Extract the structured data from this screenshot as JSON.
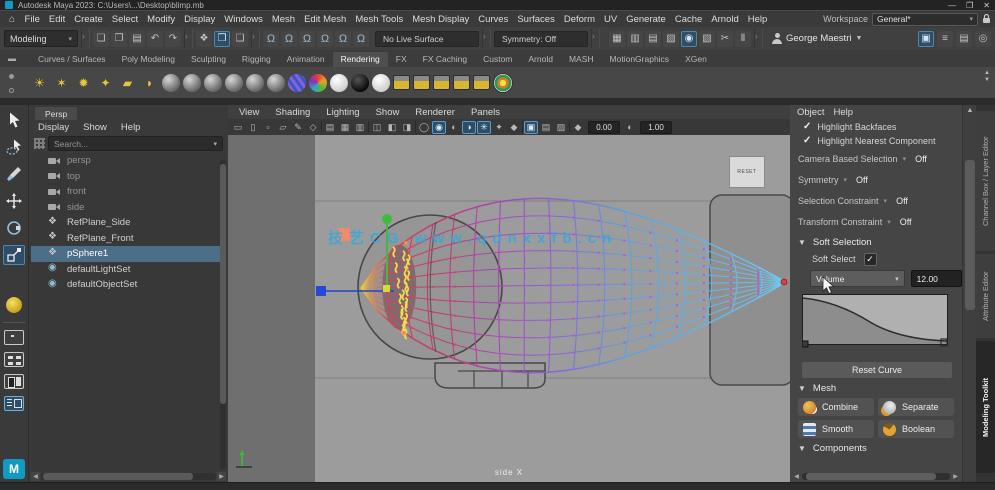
{
  "window": {
    "title": "Autodesk Maya 2023: C:\\Users\\...\\Desktop\\blimp.mb",
    "minimize": "—",
    "maximize": "❐",
    "close": "✕"
  },
  "menubar": {
    "home_icon": "⌂",
    "items": [
      "File",
      "Edit",
      "Create",
      "Select",
      "Modify",
      "Display",
      "Windows",
      "Mesh",
      "Edit Mesh",
      "Mesh Tools",
      "Mesh Display",
      "Curves",
      "Surfaces",
      "Deform",
      "UV",
      "Generate",
      "Cache",
      "Arnold",
      "Help"
    ],
    "workspace_label": "Workspace",
    "workspace_value": "General*",
    "workspace_arrow": "▾"
  },
  "statusline": {
    "mode": "Modeling",
    "mode_arrow": "▾",
    "file_icons": [
      {
        "name": "new-scene-icon",
        "glyph": "❏"
      },
      {
        "name": "open-scene-icon",
        "glyph": "❐"
      },
      {
        "name": "save-scene-icon",
        "glyph": "▤"
      },
      {
        "name": "undo-icon",
        "glyph": "↶"
      },
      {
        "name": "redo-icon",
        "glyph": "↷"
      }
    ],
    "select_icons": [
      {
        "name": "select-hierarchy-icon",
        "glyph": "❖"
      },
      {
        "name": "select-object-icon",
        "glyph": "❒",
        "active": true
      },
      {
        "name": "select-component-icon",
        "glyph": "❑"
      }
    ],
    "snap_icons": [
      {
        "name": "snap-grid-icon",
        "glyph": "Ω"
      },
      {
        "name": "snap-curve-icon",
        "glyph": "Ω"
      },
      {
        "name": "snap-point-icon",
        "glyph": "Ω"
      },
      {
        "name": "snap-projected-center-icon",
        "glyph": "Ω"
      },
      {
        "name": "snap-view-plane-icon",
        "glyph": "Ω"
      },
      {
        "name": "make-live-icon",
        "glyph": "Ω"
      }
    ],
    "live_surface": "No Live Surface",
    "symmetry": "Symmetry: Off",
    "render_icons": [
      {
        "name": "render-view-icon",
        "glyph": "▦"
      },
      {
        "name": "ipr-render-icon",
        "glyph": "▥"
      },
      {
        "name": "render-settings-icon",
        "glyph": "▤"
      },
      {
        "name": "hypershade-icon",
        "glyph": "▨"
      },
      {
        "name": "render-sequence-icon",
        "glyph": "◉",
        "active": true
      },
      {
        "name": "light-editor-icon",
        "glyph": "▧"
      },
      {
        "name": "cut-icon",
        "glyph": "✂"
      },
      {
        "name": "pause-viewport-icon",
        "glyph": "Ⅱ"
      }
    ],
    "user": "George Maestri",
    "user_arrow": "▼",
    "sidebar_icons": [
      {
        "name": "modeling-toolkit-toggle-icon",
        "glyph": "▣",
        "active": true
      },
      {
        "name": "character-controls-icon",
        "glyph": "≡"
      },
      {
        "name": "channel-box-toggle-icon",
        "glyph": "▤"
      },
      {
        "name": "attribute-editor-toggle-icon",
        "glyph": "◎"
      }
    ]
  },
  "shelf": {
    "collapse_icon": "▬",
    "spinner_up": "▲",
    "spinner_down": "▼",
    "tabs": [
      {
        "label": "Curves / Surfaces"
      },
      {
        "label": "Poly Modeling"
      },
      {
        "label": "Sculpting"
      },
      {
        "label": "Rigging"
      },
      {
        "label": "Animation"
      },
      {
        "label": "Rendering",
        "active": true
      },
      {
        "label": "FX"
      },
      {
        "label": "FX Caching"
      },
      {
        "label": "Custom"
      },
      {
        "label": "Arnold"
      },
      {
        "label": "MASH"
      },
      {
        "label": "MotionGraphics"
      },
      {
        "label": "XGen"
      }
    ],
    "items": [
      {
        "name": "ambient-light-icon",
        "type": "light",
        "glyph": "☀"
      },
      {
        "name": "directional-light-icon",
        "type": "light",
        "glyph": "✶"
      },
      {
        "name": "point-light-icon",
        "type": "light",
        "glyph": "✹"
      },
      {
        "name": "spot-light-icon",
        "type": "light",
        "glyph": "✦"
      },
      {
        "name": "area-light-icon",
        "type": "light",
        "glyph": "▰"
      },
      {
        "name": "volume-light-icon",
        "type": "light",
        "glyph": "◗"
      },
      {
        "name": "material-ball-1",
        "type": "ball"
      },
      {
        "name": "material-ball-2",
        "type": "ball"
      },
      {
        "name": "material-ball-3",
        "type": "ball"
      },
      {
        "name": "material-ball-4",
        "type": "ball"
      },
      {
        "name": "material-ball-5",
        "type": "ball"
      },
      {
        "name": "material-ball-6",
        "type": "ball"
      },
      {
        "name": "arnold-shader-ball",
        "type": "ball-arnold"
      },
      {
        "name": "ramp-shader-ball",
        "type": "ball-ramp"
      },
      {
        "name": "white-shader-ball",
        "type": "ball-white"
      },
      {
        "name": "black-shader-ball",
        "type": "ball-black"
      },
      {
        "name": "white-shader-ball-2",
        "type": "ball-white"
      },
      {
        "name": "render-clap-1",
        "type": "clap"
      },
      {
        "name": "render-clap-2",
        "type": "clap"
      },
      {
        "name": "render-clap-3",
        "type": "clap"
      },
      {
        "name": "render-clap-4",
        "type": "clap"
      },
      {
        "name": "render-clap-5",
        "type": "clap"
      },
      {
        "name": "render-target-icon",
        "type": "target"
      }
    ]
  },
  "toolbox": {
    "maya_logo": "M"
  },
  "outliner": {
    "tab": "Persp",
    "menus": [
      "Display",
      "Show",
      "Help"
    ],
    "search_placeholder": "Search...",
    "dropdown_arrow": "▾",
    "items": [
      {
        "label": "persp",
        "icon": "camera",
        "dim": true
      },
      {
        "label": "top",
        "icon": "camera",
        "dim": true
      },
      {
        "label": "front",
        "icon": "camera",
        "dim": true
      },
      {
        "label": "side",
        "icon": "camera",
        "dim": true
      },
      {
        "label": "RefPlane_Side",
        "icon": "transform"
      },
      {
        "label": "RefPlane_Front",
        "icon": "transform"
      },
      {
        "label": "pSphere1",
        "icon": "transform",
        "selected": true
      },
      {
        "label": "defaultLightSet",
        "icon": "set"
      },
      {
        "label": "defaultObjectSet",
        "icon": "set"
      }
    ]
  },
  "viewport": {
    "menus": [
      "View",
      "Shading",
      "Lighting",
      "Show",
      "Renderer",
      "Panels"
    ],
    "toolbar_icons": [
      {
        "name": "camera-select-icon",
        "glyph": "▭"
      },
      {
        "name": "camera-attributes-icon",
        "glyph": "▯"
      },
      {
        "name": "bookmarks-icon",
        "glyph": "▫"
      },
      {
        "name": "image-plane-icon",
        "glyph": "▱"
      },
      {
        "name": "grease-pencil-icon",
        "glyph": "✎"
      },
      {
        "name": "two-d-pan-zoom-icon",
        "glyph": "◇"
      },
      {
        "name": "vp-div-1",
        "divider": true
      },
      {
        "name": "wireframe-icon",
        "glyph": "▤"
      },
      {
        "name": "smooth-shade-icon",
        "glyph": "▦"
      },
      {
        "name": "textured-icon",
        "glyph": "▥"
      },
      {
        "name": "vp-div-2",
        "divider": true
      },
      {
        "name": "use-default-material-icon",
        "glyph": "◫"
      },
      {
        "name": "shadows-icon",
        "glyph": "◧"
      },
      {
        "name": "occlusion-icon",
        "glyph": "◨"
      },
      {
        "name": "vp-div-3",
        "divider": true
      },
      {
        "name": "isolate-select-icon",
        "glyph": "◯"
      },
      {
        "name": "xray-icon",
        "glyph": "◉",
        "active": true
      },
      {
        "name": "wireframe-on-shaded-icon",
        "glyph": "◐"
      },
      {
        "name": "default-lighting-icon",
        "glyph": "◑",
        "active": true
      },
      {
        "name": "screen-space-ao-icon",
        "glyph": "✳",
        "active": true
      },
      {
        "name": "motion-blur-icon",
        "glyph": "✦"
      },
      {
        "name": "anti-alias-icon",
        "glyph": "◆"
      },
      {
        "name": "vp-div-4",
        "divider": true
      },
      {
        "name": "snap-to-grid-icon",
        "glyph": "▣",
        "active": true
      },
      {
        "name": "film-gate-icon",
        "glyph": "▤"
      },
      {
        "name": "resolution-gate-icon",
        "glyph": "▨"
      },
      {
        "name": "vp-div-5",
        "divider": true
      },
      {
        "name": "exposure-icon",
        "glyph": "◆"
      }
    ],
    "exposure": "0.00",
    "gamma_icon": "◐",
    "gamma": "1.00",
    "watermark": "技艺CG  www.qdnxxfb.cn",
    "reset_label": "RESET",
    "camera_label": "side X"
  },
  "toolkit": {
    "menus": [
      "Object",
      "Help"
    ],
    "checkboxes": [
      {
        "label": "Highlight Backfaces",
        "checked": true,
        "check": "✓"
      },
      {
        "label": "Highlight Nearest Component",
        "checked": true,
        "check": "✓"
      }
    ],
    "rows": [
      {
        "label": "Camera Based Selection",
        "arrow": "▾",
        "value": "Off"
      },
      {
        "label": "Symmetry",
        "arrow": "▾",
        "value": "Off"
      },
      {
        "label": "Selection Constraint",
        "arrow": "▾",
        "value": "Off"
      },
      {
        "label": "Transform Constraint",
        "arrow": "▾",
        "value": "Off"
      }
    ],
    "soft_selection": {
      "tri": "▼",
      "title": "Soft Selection",
      "soft_select_label": "Soft Select",
      "check": "✓",
      "falloff_mode": "Volume",
      "falloff_arrow": "▾",
      "falloff_radius": "12.00",
      "reset_button": "Reset Curve"
    },
    "mesh": {
      "tri": "▼",
      "title": "Mesh",
      "buttons": [
        {
          "label": "Combine",
          "icon": "combine"
        },
        {
          "label": "Separate",
          "icon": "separate"
        },
        {
          "label": "Smooth",
          "icon": "smooth"
        },
        {
          "label": "Boolean",
          "icon": "boolean"
        }
      ]
    },
    "components_tri": "▼",
    "components_title": "Components"
  },
  "side_tabs": [
    {
      "label": "Channel Box / Layer Editor",
      "cls": "t1"
    },
    {
      "label": "Attribute Editor",
      "cls": "t2"
    },
    {
      "label": "Modeling Toolkit",
      "cls": "t3",
      "active": true
    }
  ],
  "colors": {
    "accent": "#5285a6",
    "selection_row": "#4d6e87",
    "maya_logo_bg": "#0f9bc4",
    "watermark": "#2fa8e0",
    "viewport_bg": "#6f6f6f",
    "reference_bg": "#9c9c9c",
    "soft_falloff_gradient": [
      "#e8cc44",
      "#d84452",
      "#c23a6a",
      "#a44ab8",
      "#8668d8",
      "#5aa0e0",
      "#70c8ec"
    ]
  }
}
